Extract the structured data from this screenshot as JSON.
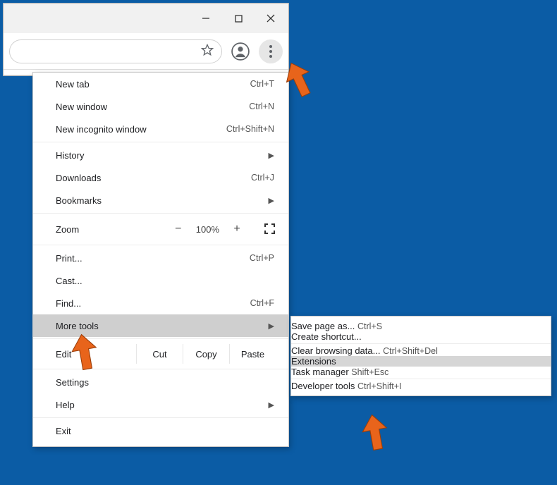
{
  "menu": {
    "items": [
      {
        "label": "New tab",
        "shortcut": "Ctrl+T"
      },
      {
        "label": "New window",
        "shortcut": "Ctrl+N"
      },
      {
        "label": "New incognito window",
        "shortcut": "Ctrl+Shift+N"
      },
      {
        "label": "History",
        "submenu": true
      },
      {
        "label": "Downloads",
        "shortcut": "Ctrl+J"
      },
      {
        "label": "Bookmarks",
        "submenu": true
      },
      {
        "label": "Zoom",
        "zoom": "100%"
      },
      {
        "label": "Print...",
        "shortcut": "Ctrl+P"
      },
      {
        "label": "Cast..."
      },
      {
        "label": "Find...",
        "shortcut": "Ctrl+F"
      },
      {
        "label": "More tools",
        "submenu": true
      },
      {
        "label": "Edit",
        "cut": "Cut",
        "copy": "Copy",
        "paste": "Paste"
      },
      {
        "label": "Settings"
      },
      {
        "label": "Help",
        "submenu": true
      },
      {
        "label": "Exit"
      }
    ]
  },
  "submenu": {
    "items": [
      {
        "label": "Save page as...",
        "shortcut": "Ctrl+S"
      },
      {
        "label": "Create shortcut..."
      },
      {
        "label": "Clear browsing data...",
        "shortcut": "Ctrl+Shift+Del"
      },
      {
        "label": "Extensions"
      },
      {
        "label": "Task manager",
        "shortcut": "Shift+Esc"
      },
      {
        "label": "Developer tools",
        "shortcut": "Ctrl+Shift+I"
      }
    ]
  },
  "zoom_controls": {
    "minus": "−",
    "plus": "+"
  }
}
